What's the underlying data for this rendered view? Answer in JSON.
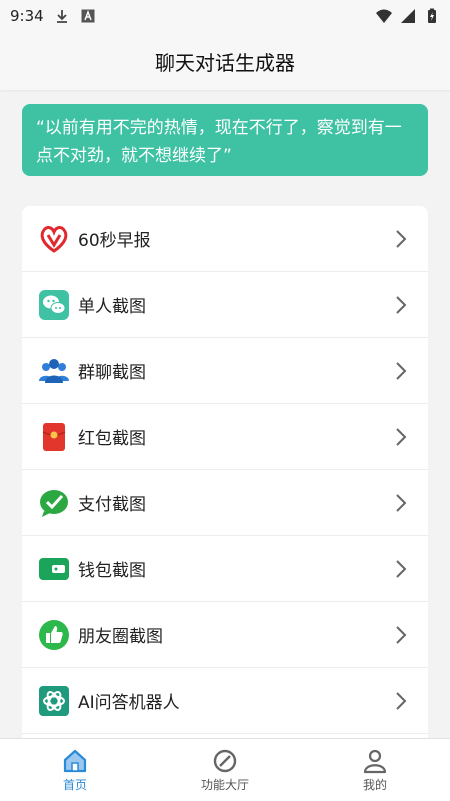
{
  "status": {
    "time": "9:34"
  },
  "header": {
    "title": "聊天对话生成器"
  },
  "quote": {
    "text": "“以前有用不完的热情，现在不行了，察觉到有一点不对劲，就不想继续了”"
  },
  "menu": [
    {
      "label": "60秒早报",
      "icon": "heart-logo-icon"
    },
    {
      "label": "单人截图",
      "icon": "wechat-icon"
    },
    {
      "label": "群聊截图",
      "icon": "group-users-icon"
    },
    {
      "label": "红包截图",
      "icon": "red-packet-icon"
    },
    {
      "label": "支付截图",
      "icon": "payment-check-icon"
    },
    {
      "label": "钱包截图",
      "icon": "wallet-icon"
    },
    {
      "label": "朋友圈截图",
      "icon": "thumbs-up-icon"
    },
    {
      "label": "AI问答机器人",
      "icon": "ai-bot-icon"
    }
  ],
  "tabs": [
    {
      "label": "首页",
      "icon": "home-icon",
      "active": true
    },
    {
      "label": "功能大厅",
      "icon": "compass-icon",
      "active": false
    },
    {
      "label": "我的",
      "icon": "person-icon",
      "active": false
    }
  ],
  "colors": {
    "accent": "#3ec2a3",
    "tab_active": "#2a8ad8"
  }
}
